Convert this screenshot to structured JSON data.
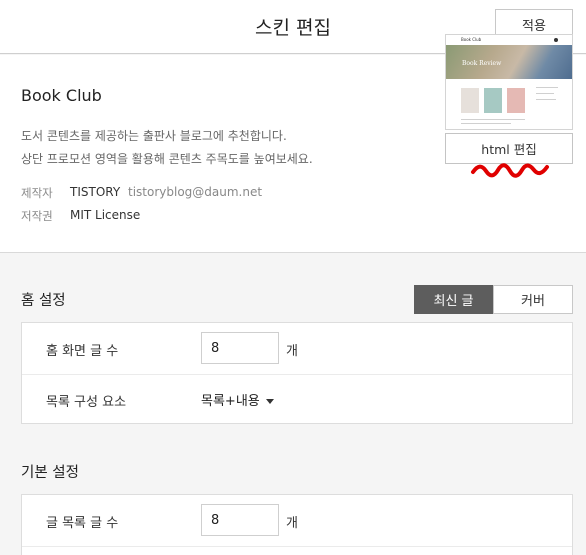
{
  "header": {
    "title": "스킨 편집",
    "apply_label": "적용"
  },
  "skin": {
    "name": "Book Club",
    "desc_line1": "도서 콘텐츠를 제공하는 출판사 블로그에 추천합니다.",
    "desc_line2": "상단 프로모션 영역을 활용해 콘텐츠 주목도를 높여보세요.",
    "author_label": "제작자",
    "author_name": "TISTORY",
    "author_email": "tistoryblog@daum.net",
    "license_label": "저작권",
    "license_value": "MIT License",
    "thumbnail": {
      "logo_text": "Book Club",
      "hero_text": "Book Review"
    },
    "html_edit_label": "html 편집"
  },
  "home_settings": {
    "title": "홈 설정",
    "tabs": [
      {
        "label": "최신 글",
        "active": true
      },
      {
        "label": "커버",
        "active": false
      }
    ],
    "post_count_label": "홈 화면 글 수",
    "post_count_value": "8",
    "post_count_unit": "개",
    "list_element_label": "목록 구성 요소",
    "list_element_value": "목록+내용"
  },
  "basic_settings": {
    "title": "기본 설정",
    "list_count_label": "글 목록 글 수",
    "list_count_value": "8",
    "list_count_unit": "개"
  },
  "colors": {
    "active_tab_bg": "#5d5d5d",
    "annotation_red": "#e00000"
  }
}
